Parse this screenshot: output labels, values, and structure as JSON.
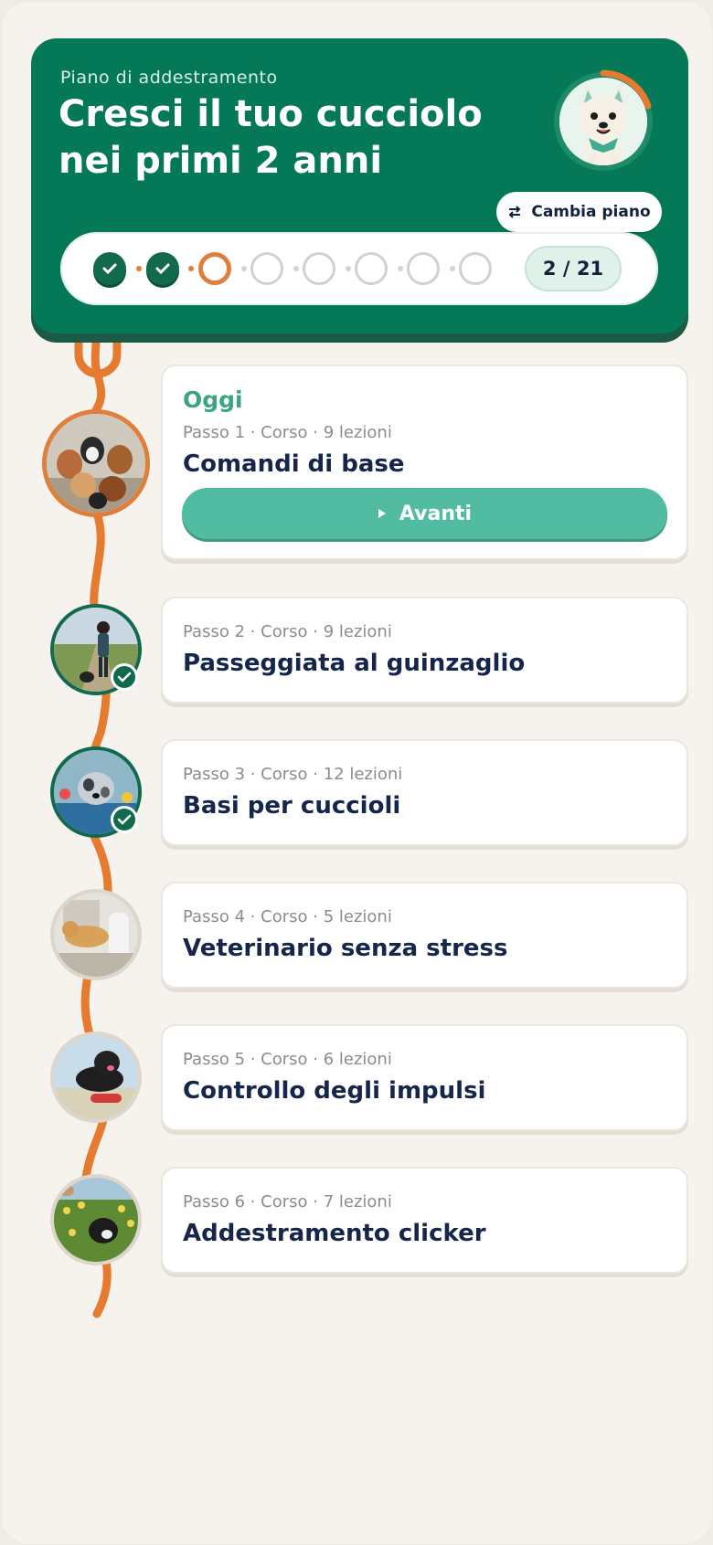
{
  "header": {
    "eyebrow": "Piano di addestramento",
    "title_line1": "Cresci il tuo cucciolo",
    "title_line2": "nei primi 2 anni",
    "change_plan_label": "Cambia piano",
    "progress_counter": "2 / 21",
    "progress_completed": 2,
    "progress_total": 21,
    "mascot_icon": "puppy-mascot-icon"
  },
  "colors": {
    "brand_green": "#047857",
    "accent_orange": "#e07f3c",
    "mint": "#52bca3",
    "navy": "#15264a"
  },
  "steps": [
    {
      "today_label": "Oggi",
      "meta": "Passo 1 · Corso · 9 lezioni",
      "title": "Comandi di base",
      "cta_label": "Avanti",
      "status": "current"
    },
    {
      "meta": "Passo 2 · Corso · 9 lezioni",
      "title": "Passeggiata al guinzaglio",
      "status": "done"
    },
    {
      "meta": "Passo 3 · Corso · 12 lezioni",
      "title": "Basi per cuccioli",
      "status": "done"
    },
    {
      "meta": "Passo 4 · Corso · 5 lezioni",
      "title": "Veterinario senza stress",
      "status": "todo"
    },
    {
      "meta": "Passo 5 · Corso · 6 lezioni",
      "title": "Controllo degli impulsi",
      "status": "todo"
    },
    {
      "meta": "Passo 6 · Corso · 7 lezioni",
      "title": "Addestramento clicker",
      "status": "todo"
    }
  ]
}
